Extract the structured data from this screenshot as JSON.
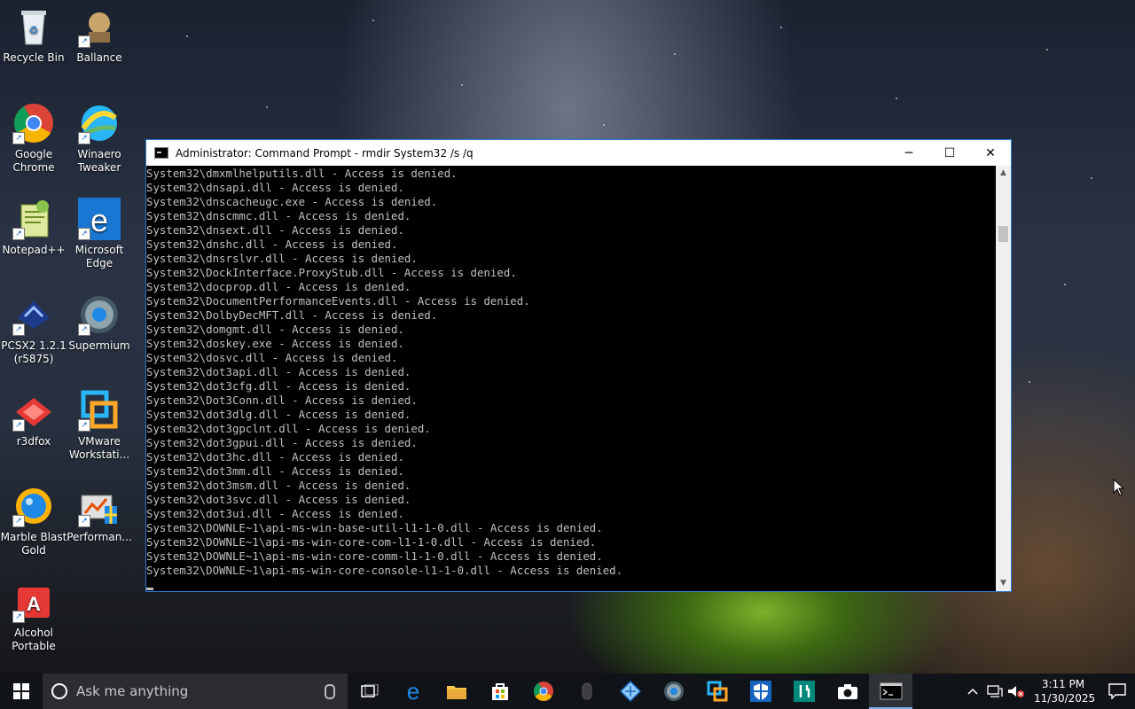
{
  "desktop": {
    "icons": [
      {
        "label": "Recycle Bin",
        "icon": "recycle-bin-icon"
      },
      {
        "label": "Ballance",
        "icon": "ballance-icon"
      },
      {
        "label": "Google Chrome",
        "icon": "chrome-icon"
      },
      {
        "label": "Winaero Tweaker",
        "icon": "winaero-tweaker-icon"
      },
      {
        "label": "Notepad++",
        "icon": "notepad-plus-plus-icon"
      },
      {
        "label": "Microsoft Edge",
        "icon": "edge-icon"
      },
      {
        "label": "PCSX2 1.2.1 (r5875)",
        "icon": "pcsx2-icon"
      },
      {
        "label": "Supermium",
        "icon": "supermium-icon"
      },
      {
        "label": "r3dfox",
        "icon": "r3dfox-icon"
      },
      {
        "label": "VMware Workstati...",
        "icon": "vmware-icon"
      },
      {
        "label": "Marble Blast Gold",
        "icon": "marble-blast-icon"
      },
      {
        "label": "Performan...",
        "icon": "performance-icon"
      },
      {
        "label": "Alcohol Portable",
        "icon": "alcohol-icon"
      }
    ]
  },
  "window": {
    "title": "Administrator: Command Prompt - rmdir  System32 /s /q",
    "controls": {
      "minimize": "─",
      "maximize": "☐",
      "close": "✕"
    },
    "lines": [
      "System32\\dmxmlhelputils.dll - Access is denied.",
      "System32\\dnsapi.dll - Access is denied.",
      "System32\\dnscacheugc.exe - Access is denied.",
      "System32\\dnscmmc.dll - Access is denied.",
      "System32\\dnsext.dll - Access is denied.",
      "System32\\dnshc.dll - Access is denied.",
      "System32\\dnsrslvr.dll - Access is denied.",
      "System32\\DockInterface.ProxyStub.dll - Access is denied.",
      "System32\\docprop.dll - Access is denied.",
      "System32\\DocumentPerformanceEvents.dll - Access is denied.",
      "System32\\DolbyDecMFT.dll - Access is denied.",
      "System32\\domgmt.dll - Access is denied.",
      "System32\\doskey.exe - Access is denied.",
      "System32\\dosvc.dll - Access is denied.",
      "System32\\dot3api.dll - Access is denied.",
      "System32\\dot3cfg.dll - Access is denied.",
      "System32\\Dot3Conn.dll - Access is denied.",
      "System32\\dot3dlg.dll - Access is denied.",
      "System32\\dot3gpclnt.dll - Access is denied.",
      "System32\\dot3gpui.dll - Access is denied.",
      "System32\\dot3hc.dll - Access is denied.",
      "System32\\dot3mm.dll - Access is denied.",
      "System32\\dot3msm.dll - Access is denied.",
      "System32\\dot3svc.dll - Access is denied.",
      "System32\\dot3ui.dll - Access is denied.",
      "System32\\DOWNLE~1\\api-ms-win-base-util-l1-1-0.dll - Access is denied.",
      "System32\\DOWNLE~1\\api-ms-win-core-com-l1-1-0.dll - Access is denied.",
      "System32\\DOWNLE~1\\api-ms-win-core-comm-l1-1-0.dll - Access is denied.",
      "System32\\DOWNLE~1\\api-ms-win-core-console-l1-1-0.dll - Access is denied."
    ]
  },
  "taskbar": {
    "search_placeholder": "Ask me anything",
    "apps": [
      {
        "name": "task-view",
        "icon": "task-view-icon"
      },
      {
        "name": "edge",
        "icon": "edge-icon"
      },
      {
        "name": "file-explorer",
        "icon": "folder-icon"
      },
      {
        "name": "store",
        "icon": "store-icon"
      },
      {
        "name": "chrome",
        "icon": "chrome-icon"
      },
      {
        "name": "mouse",
        "icon": "mouse-icon"
      },
      {
        "name": "network-app",
        "icon": "diamond-icon"
      },
      {
        "name": "supermium",
        "icon": "supermium-icon"
      },
      {
        "name": "vmware",
        "icon": "vmware-icon"
      },
      {
        "name": "defender",
        "icon": "shield-icon"
      },
      {
        "name": "tool-app",
        "icon": "tool-icon"
      },
      {
        "name": "camera",
        "icon": "camera-icon"
      },
      {
        "name": "command-prompt",
        "icon": "cmd-icon"
      }
    ],
    "clock": {
      "time": "3:11 PM",
      "date": "11/30/2025"
    }
  },
  "colors": {
    "console_bg": "#000000",
    "console_text": "#c0c0c0",
    "window_border": "#2b79d6",
    "taskbar_bg": "#101418",
    "accent": "#7fb2ec"
  }
}
